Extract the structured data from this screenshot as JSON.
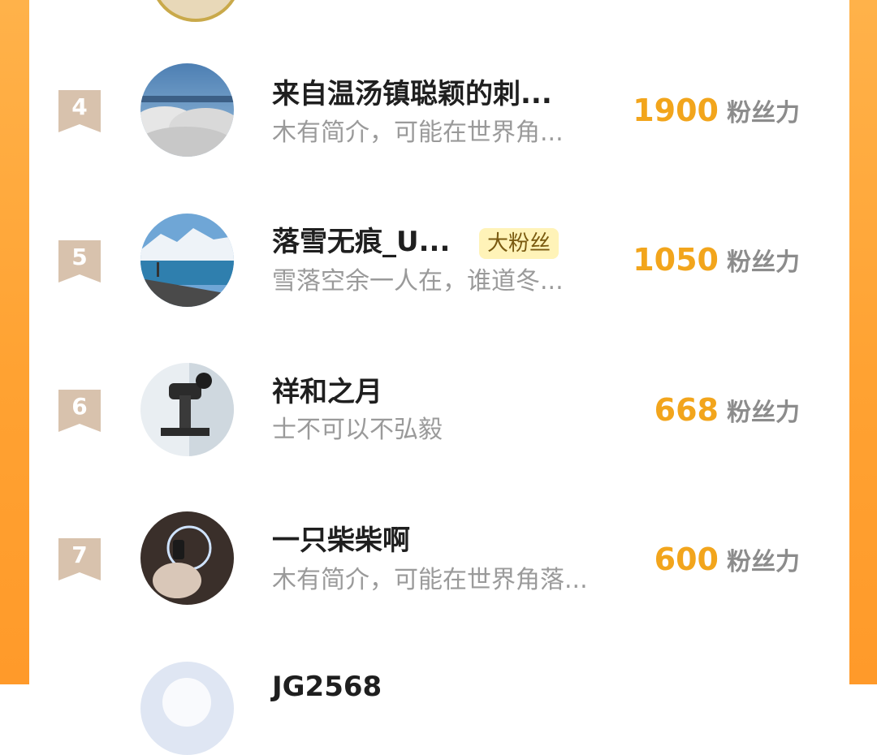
{
  "rows": [
    {
      "rank": "4",
      "name": "来自温汤镇聪颖的刺...",
      "badge": "",
      "bio": "木有简介，可能在世界角...",
      "fans": "1900",
      "fans_unit": "粉丝力"
    },
    {
      "rank": "5",
      "name": "落雪无痕_U...",
      "badge": "大粉丝",
      "bio": "雪落空余一人在，谁道冬...",
      "fans": "1050",
      "fans_unit": "粉丝力"
    },
    {
      "rank": "6",
      "name": "祥和之月",
      "badge": "",
      "bio": "士不可以不弘毅",
      "fans": "668",
      "fans_unit": "粉丝力"
    },
    {
      "rank": "7",
      "name": "一只柴柴啊",
      "badge": "",
      "bio": "木有简介，可能在世界角落...",
      "fans": "600",
      "fans_unit": "粉丝力"
    },
    {
      "rank": "",
      "name": "JG2568",
      "badge": "",
      "bio": "",
      "fans": "",
      "fans_unit": ""
    }
  ],
  "colors": {
    "accent_orange": "#ffa232",
    "fans_number": "#f2a51c",
    "rank_flag": "#d8c2ad",
    "badge_bg": "#fff3b8"
  },
  "icons": {
    "rank_flag": "ribbon-flag-icon"
  }
}
